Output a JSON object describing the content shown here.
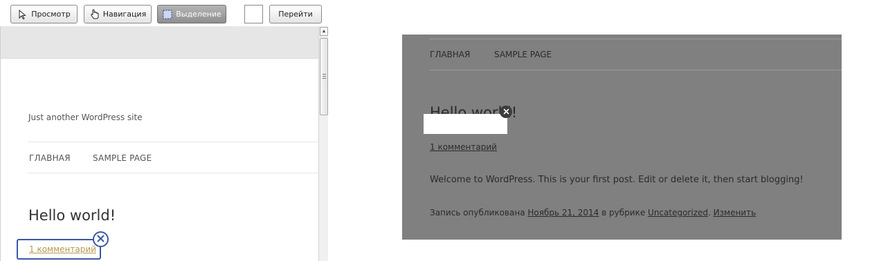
{
  "toolbar": {
    "view_label": "Просмотр",
    "navigation_label": "Навигация",
    "selection_label": "Выделение",
    "go_label": "Перейти"
  },
  "site": {
    "tagline": "Just another WordPress site",
    "nav": [
      "ГЛАВНАЯ",
      "SAMPLE PAGE"
    ]
  },
  "post": {
    "title": "Hello world!",
    "comments": "1 комментарий",
    "body": "Welcome to WordPress. This is your first post. Edit or delete it, then start blogging!",
    "meta": {
      "prefix": "Запись опубликована",
      "date": "Ноябрь 21, 2014",
      "category_prefix": "в рубрике",
      "category": "Uncategorized",
      "edit": "Изменить"
    }
  },
  "colors": {
    "selection_border": "#3a56a8",
    "comment_link_left": "#b59a4f",
    "overlay": "#808080"
  },
  "icons": {
    "view": "cursor-arrow-icon",
    "navigation": "hand-pointer-icon",
    "selection": "dashed-selection-icon",
    "close": "close-x-icon"
  }
}
